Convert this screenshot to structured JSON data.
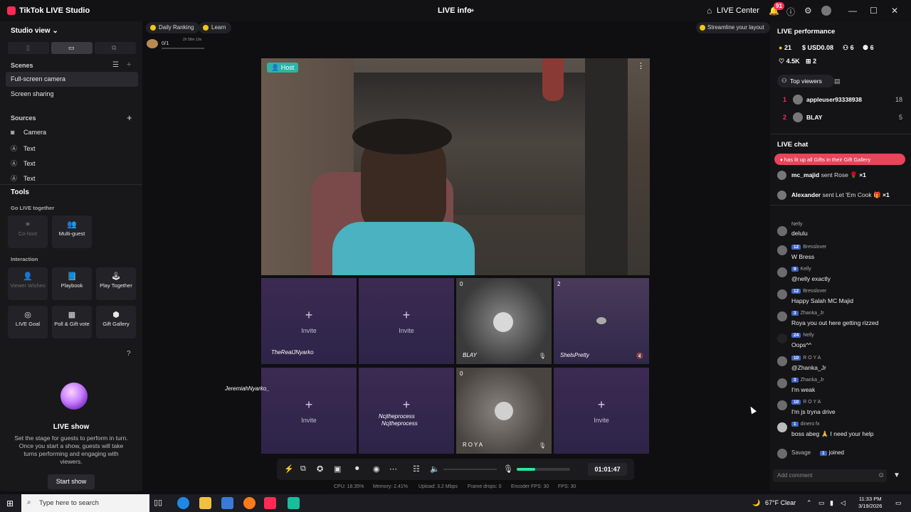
{
  "titlebar": {
    "app_title": "TikTok LIVE Studio",
    "center_title": "LIVE info",
    "share_icon": "share-icon",
    "live_center": "LIVE Center",
    "notif_count": "91"
  },
  "left": {
    "studio_view": "Studio view",
    "scenes_label": "Scenes",
    "scenes": [
      "Full-screen camera",
      "Screen sharing"
    ],
    "sources_label": "Sources",
    "sources": [
      {
        "icon": "camera-icon",
        "label": "Camera"
      },
      {
        "icon": "text-icon",
        "label": "Text"
      },
      {
        "icon": "text-icon",
        "label": "Text"
      },
      {
        "icon": "text-icon",
        "label": "Text"
      }
    ],
    "tools_label": "Tools",
    "go_live_label": "Go LIVE together",
    "cohost": "Co-host",
    "multiguest": "Multi-guest",
    "interaction_label": "Interaction",
    "viewer_wishes": "Viewer Wishes",
    "playbook": "Playbook",
    "play_together": "Play Together",
    "live_goal": "LIVE Goal",
    "poll_gift": "Poll & Gift vote",
    "gift_gallery": "Gift Gallery",
    "liveshow_title": "LIVE show",
    "liveshow_desc": "Set the stage for guests to perform in turn. Once you start a show, guests will take turns performing and engaging with viewers.",
    "start_show": "Start show"
  },
  "center": {
    "daily_ranking": "Daily Ranking",
    "learn": "Learn",
    "progress_text": "0/1",
    "progress_time": "2h 58m 19s",
    "streamline": "Streamline your layout",
    "host_badge": "Host",
    "invite": "Invite",
    "cells": {
      "c1_name": "TheRealJNyarko",
      "c3_count": "0",
      "c3_name": "BLAY",
      "c4_count": "2",
      "c4_name": "ShelsPretty",
      "c6_name1": "Ncjtheprocess",
      "c6_name2": "Ncjtheprocess",
      "c7_count": "0",
      "c7_name": "ROYA"
    },
    "side_name": "JeremiahNyarko_",
    "timer": "01:01:47",
    "stats": {
      "cpu": "CPU: 18.35%",
      "memory": "Memory: 2.41%",
      "upload": "Upload: 3.2 Mbps",
      "drops": "Frame drops: 0",
      "encoder": "Encoder FPS: 30",
      "fps": "FPS: 30"
    }
  },
  "right": {
    "perf_title": "LIVE performance",
    "coins": "21",
    "usd": "USD0.08",
    "m3": "6",
    "m4": "6",
    "likes": "4.5K",
    "gifts": "2",
    "top_viewers": "Top viewers",
    "viewers": [
      {
        "rank": "1",
        "name": "appleuser93338938",
        "count": "18"
      },
      {
        "rank": "2",
        "name": "BLAY",
        "count": "5"
      }
    ],
    "chat_title": "LIVE chat",
    "gift_banner": "has lit up all Gifts in their Gift Gallery",
    "gift_events": [
      {
        "user": "mc_majid",
        "action": "sent Rose",
        "mult": "×1"
      },
      {
        "user": "Alexander",
        "action": "sent Let 'Em Cook",
        "mult": "×1"
      }
    ],
    "chat": [
      {
        "lvl": "",
        "user": "Nelly",
        "text": "delulu"
      },
      {
        "lvl": "12",
        "user": "Bresslover",
        "text": "W Bress"
      },
      {
        "lvl": "9",
        "user": "Kelly",
        "text": "@nelly exactly"
      },
      {
        "lvl": "12",
        "user": "Bresslover",
        "text": "Happy Salah MC Majid"
      },
      {
        "lvl": "3",
        "user": "Zhanka_Jr",
        "text": "Roya you out here getting rizzed"
      },
      {
        "lvl": "24",
        "user": "Nelly",
        "text": "Oops^^"
      },
      {
        "lvl": "10",
        "user": "R O Y A",
        "text": "@Zhanka_Jr"
      },
      {
        "lvl": "3",
        "user": "Zhanka_Jr",
        "text": "I'm weak"
      },
      {
        "lvl": "10",
        "user": "R O Y A",
        "text": "I'm js tryna drive"
      },
      {
        "lvl": "1",
        "user": "dinero fx",
        "text": "boss abeg 🙏 I need your help"
      }
    ],
    "joined_user": "Savage",
    "joined_lvl": "1",
    "joined_text": "joined",
    "comment_placeholder": "Add comment"
  },
  "taskbar": {
    "search_placeholder": "Type here to search",
    "weather": "67°F  Clear",
    "time": "11:33 PM",
    "date": "3/19/2026"
  }
}
